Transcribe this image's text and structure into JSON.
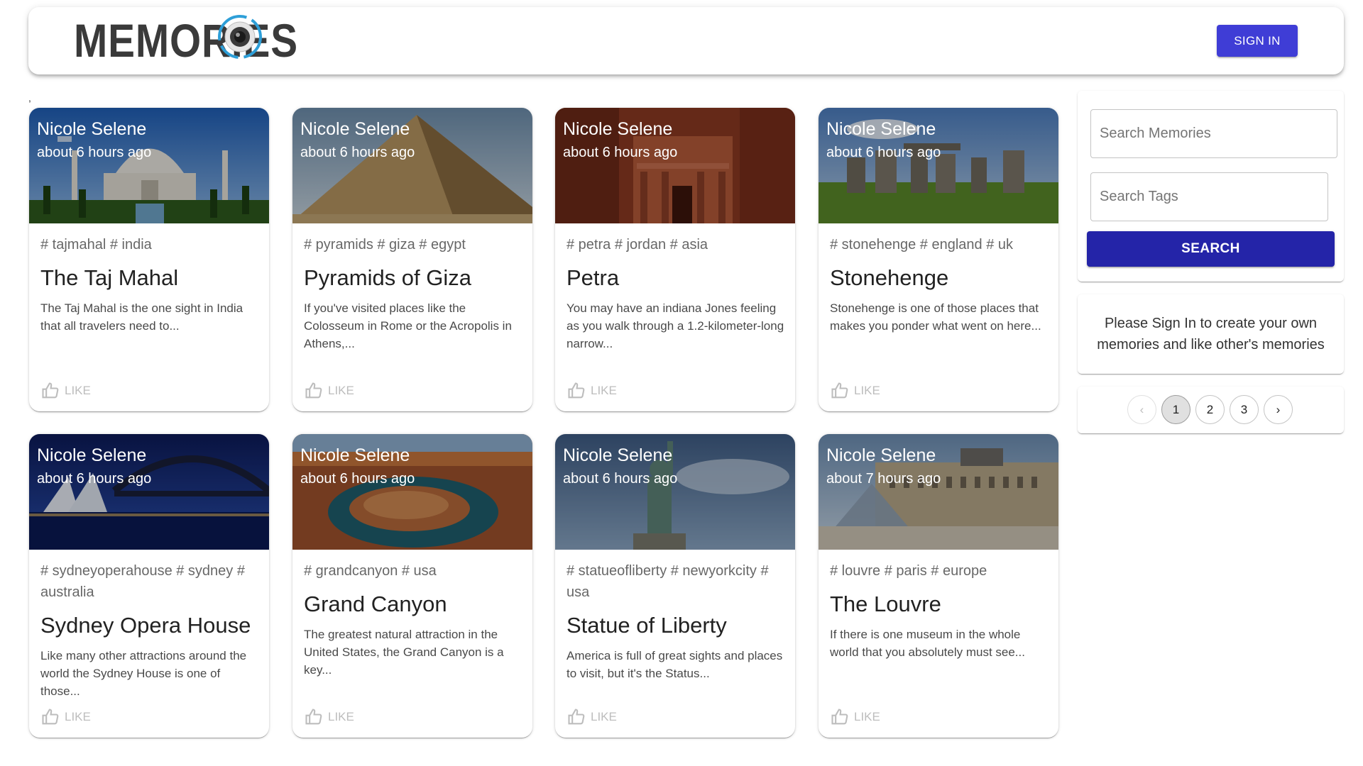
{
  "header": {
    "brand": "MEMORIES",
    "signin_label": "SIGN IN"
  },
  "stray_mark": ",",
  "posts": [
    {
      "author": "Nicole Selene",
      "time": "about 6 hours ago",
      "tags": "# tajmahal # india",
      "title": "The Taj Mahal",
      "message": "The Taj Mahal is the one sight in India that all travelers need to...",
      "like": "LIKE",
      "image": "taj-mahal-photo"
    },
    {
      "author": "Nicole Selene",
      "time": "about 6 hours ago",
      "tags": "# pyramids # giza # egypt",
      "title": "Pyramids of Giza",
      "message": "If you've visited places like the Colosseum in Rome or the Acropolis in Athens,...",
      "like": "LIKE",
      "image": "pyramid-photo"
    },
    {
      "author": "Nicole Selene",
      "time": "about 6 hours ago",
      "tags": "# petra # jordan # asia",
      "title": "Petra",
      "message": "You may have an indiana Jones feeling as you walk through a 1.2-kilometer-long narrow...",
      "like": "LIKE",
      "image": "petra-photo"
    },
    {
      "author": "Nicole Selene",
      "time": "about 6 hours ago",
      "tags": "# stonehenge # england # uk",
      "title": "Stonehenge",
      "message": "Stonehenge is one of those places that makes you ponder what went on here...",
      "like": "LIKE",
      "image": "stonehenge-photo"
    },
    {
      "author": "Nicole Selene",
      "time": "about 6 hours ago",
      "tags": "# sydneyoperahouse # sydney # australia",
      "title": "Sydney Opera House",
      "message": "Like many other attractions around the world the Sydney House is one of those...",
      "like": "LIKE",
      "image": "sydney-photo"
    },
    {
      "author": "Nicole Selene",
      "time": "about 6 hours ago",
      "tags": "# grandcanyon # usa",
      "title": "Grand Canyon",
      "message": "The greatest natural attraction in the United States, the Grand Canyon is a key...",
      "like": "LIKE",
      "image": "canyon-photo"
    },
    {
      "author": "Nicole Selene",
      "time": "about 6 hours ago",
      "tags": "# statueofliberty # newyorkcity # usa",
      "title": "Statue of Liberty",
      "message": "America is full of great sights and places to visit, but it's the Status...",
      "like": "LIKE",
      "image": "liberty-photo"
    },
    {
      "author": "Nicole Selene",
      "time": "about 7 hours ago",
      "tags": "# louvre # paris # europe",
      "title": "The Louvre",
      "message": "If there is one museum in the whole world that you absolutely must see...",
      "like": "LIKE",
      "image": "louvre-photo"
    }
  ],
  "search": {
    "memories_placeholder": "Search Memories",
    "tags_placeholder": "Search Tags",
    "button_label": "SEARCH"
  },
  "notice": "Please Sign In to create your own memories and like other's memories",
  "pagination": {
    "prev": "‹",
    "pages": [
      "1",
      "2",
      "3"
    ],
    "current": "1",
    "next": "›"
  },
  "colors": {
    "primary": "#3f3dd6",
    "search_button": "#2424a8",
    "brand_text": "#3a3a3a",
    "logo_ring": "#2e9fd8"
  }
}
